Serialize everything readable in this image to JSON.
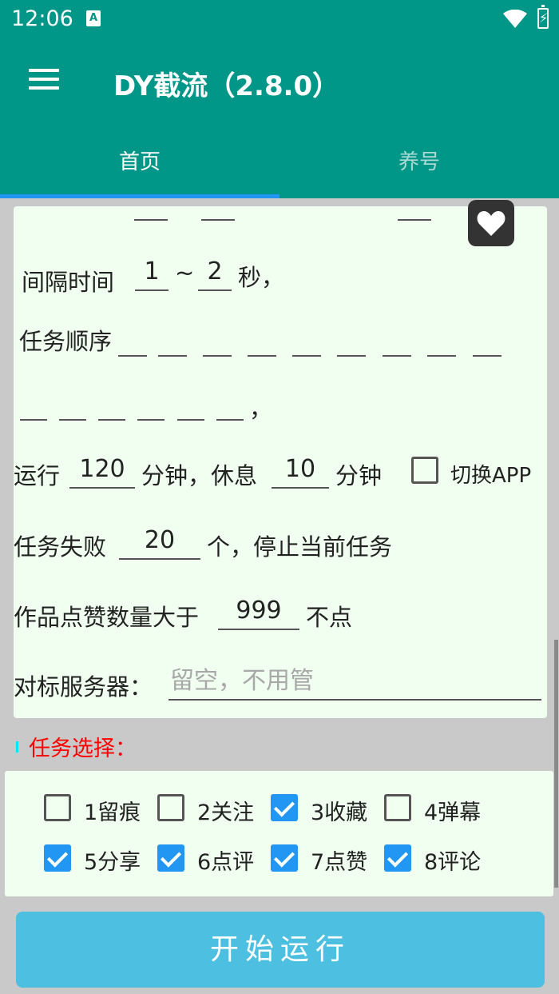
{
  "status_bar": {
    "time": "12:06",
    "notification_letter": "A"
  },
  "app_bar": {
    "title": "DY截流（2.8.0）",
    "menu_icon": "hamburger-menu-icon"
  },
  "tabs": [
    {
      "label": "首页",
      "selected": true
    },
    {
      "label": "养号",
      "selected": false
    }
  ],
  "form": {
    "interval": {
      "label": "间隔时间",
      "min": "1",
      "tilde": "~",
      "max": "2",
      "unit": "秒，"
    },
    "task_order": {
      "label": "任务顺序",
      "comma": "，"
    },
    "run": {
      "prefix": "运行",
      "run_minutes": "120",
      "mid": "分钟，休息",
      "rest_minutes": "10",
      "suffix": "分钟",
      "switch_app_label": "切换APP",
      "switch_app_checked": false
    },
    "fail": {
      "prefix": "任务失败",
      "count": "20",
      "suffix": "个，停止当前任务"
    },
    "likes": {
      "prefix": "作品点赞数量大于",
      "count": "999",
      "suffix": "不点"
    },
    "server": {
      "label": "对标服务器：",
      "placeholder": "留空，不用管"
    }
  },
  "task_section": {
    "title": "任务选择：",
    "tasks": [
      {
        "label": "1留痕",
        "checked": false
      },
      {
        "label": "2关注",
        "checked": false
      },
      {
        "label": "3收藏",
        "checked": true
      },
      {
        "label": "4弹幕",
        "checked": false
      },
      {
        "label": "5分享",
        "checked": true
      },
      {
        "label": "6点评",
        "checked": true
      },
      {
        "label": "7点赞",
        "checked": true
      },
      {
        "label": "8评论",
        "checked": true
      }
    ]
  },
  "start_button": {
    "label": "开始运行"
  },
  "colors": {
    "primary": "#009688",
    "accent": "#2196f3",
    "button": "#4dbfe0",
    "card": "#f0fff0",
    "section_label": "#ff0000"
  }
}
